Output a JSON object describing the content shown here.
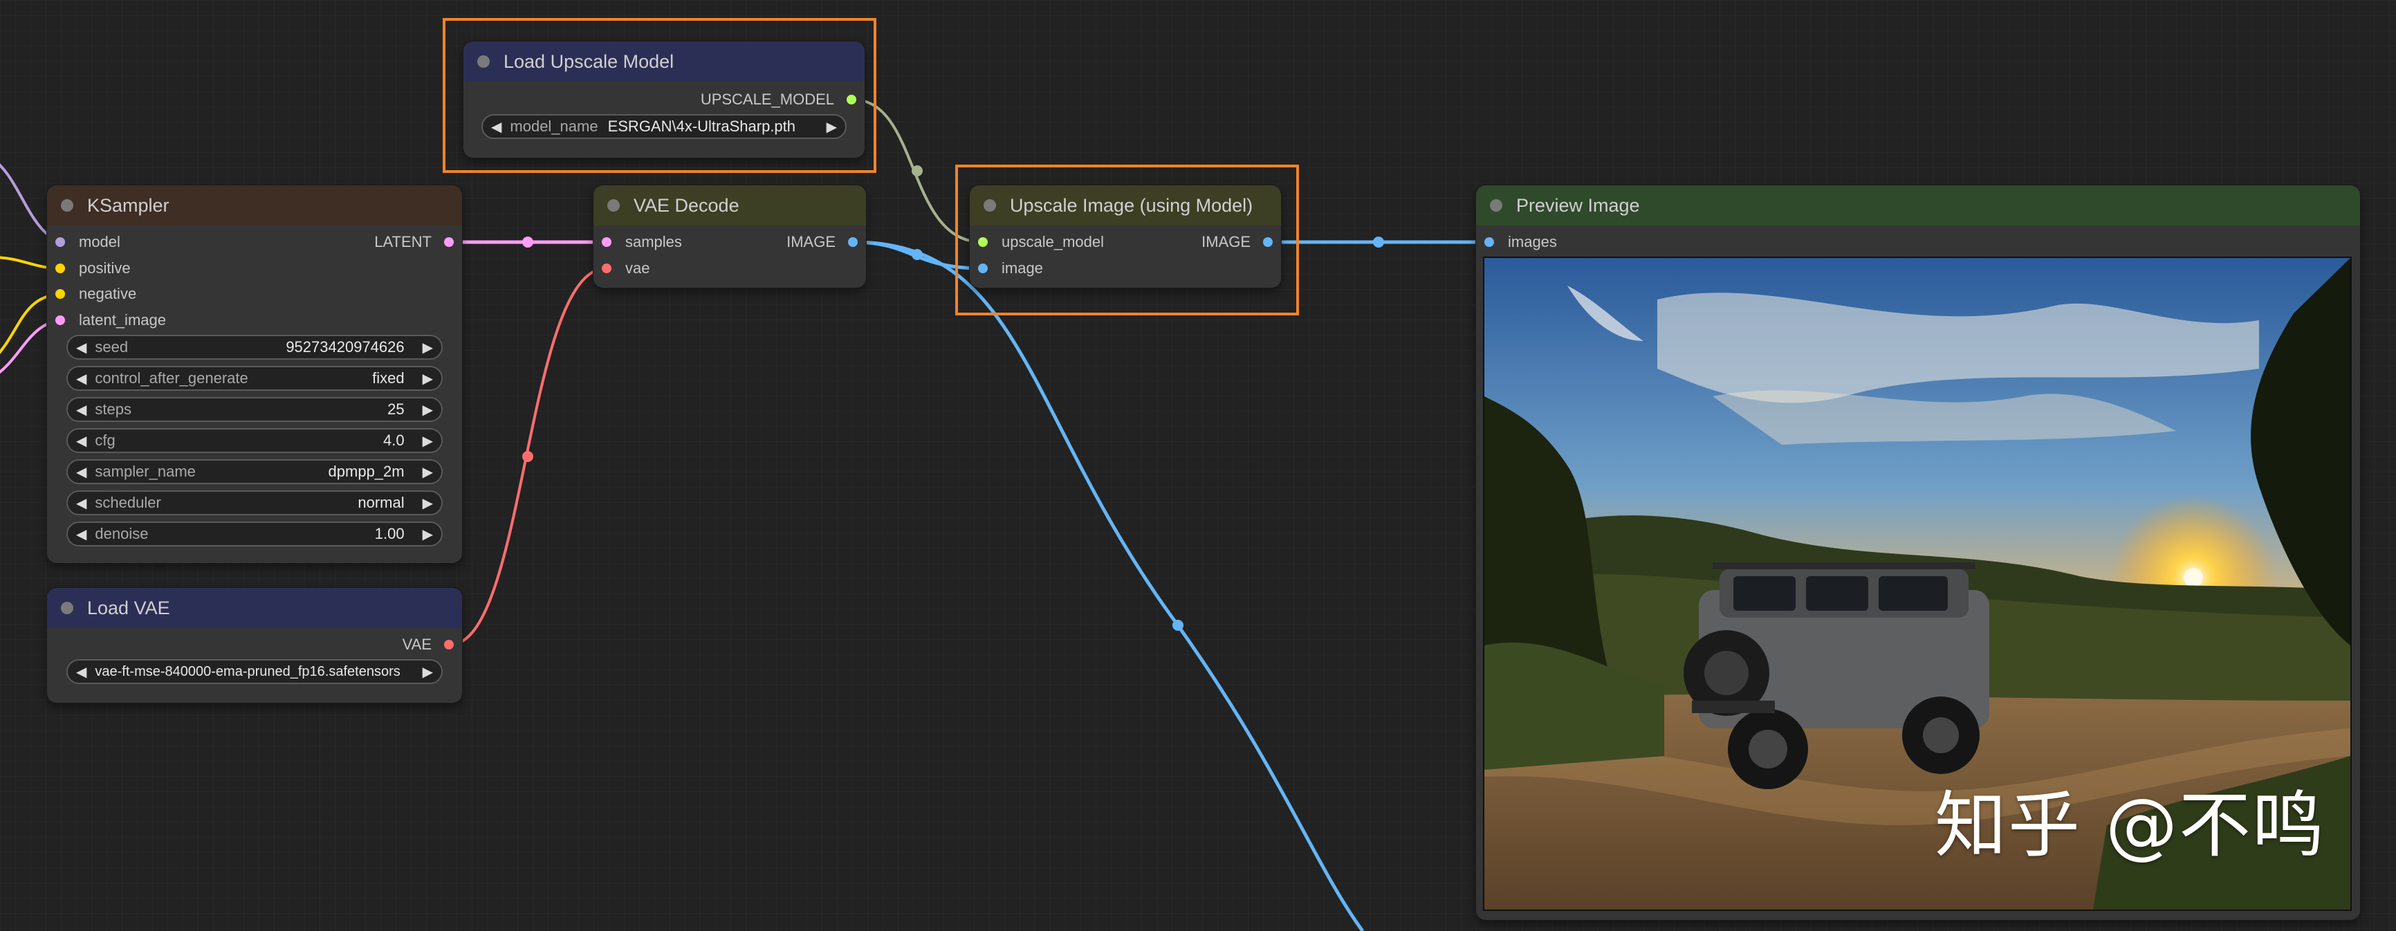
{
  "colors": {
    "model": "#b39ddb",
    "clip": "#ffd500",
    "latent": "#ff9cf9",
    "vae": "#ff6e6e",
    "image": "#64b5f6",
    "upscale_model": "#b2ff59",
    "highlight": "#f0842a"
  },
  "ksampler": {
    "title": "KSampler",
    "inputs": [
      "model",
      "positive",
      "negative",
      "latent_image"
    ],
    "output": "LATENT",
    "widgets": [
      {
        "label": "seed",
        "value": "95273420974626"
      },
      {
        "label": "control_after_generate",
        "value": "fixed"
      },
      {
        "label": "steps",
        "value": "25"
      },
      {
        "label": "cfg",
        "value": "4.0"
      },
      {
        "label": "sampler_name",
        "value": "dpmpp_2m"
      },
      {
        "label": "scheduler",
        "value": "normal"
      },
      {
        "label": "denoise",
        "value": "1.00"
      }
    ]
  },
  "load_vae": {
    "title": "Load VAE",
    "output": "VAE",
    "widget_value": "vae-ft-mse-840000-ema-pruned_fp16.safetensors"
  },
  "load_upscale_model": {
    "title": "Load Upscale Model",
    "output": "UPSCALE_MODEL",
    "widget_label": "model_name",
    "widget_value": "ESRGAN\\4x-UltraSharp.pth"
  },
  "vae_decode": {
    "title": "VAE Decode",
    "inputs": [
      "samples",
      "vae"
    ],
    "output": "IMAGE"
  },
  "upscale_image": {
    "title": "Upscale Image (using Model)",
    "inputs": [
      "upscale_model",
      "image"
    ],
    "output": "IMAGE"
  },
  "preview_image": {
    "title": "Preview Image",
    "input": "images",
    "image_description": "generated-photo-offroad-suv-at-sunset",
    "watermark": "知乎 @不鸣"
  }
}
